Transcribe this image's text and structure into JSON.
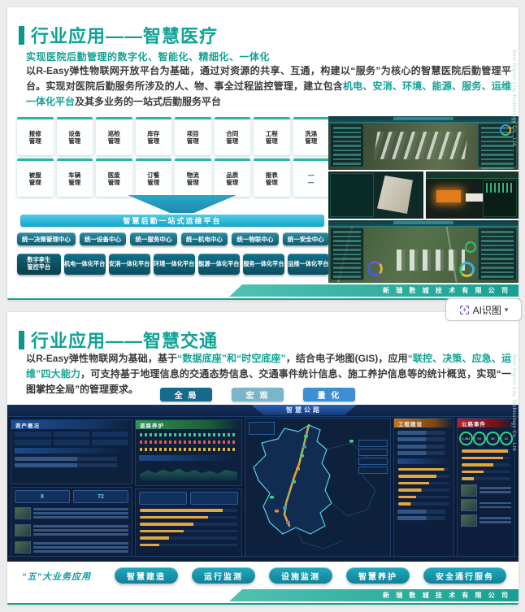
{
  "ai_tool": {
    "label": "AI识图",
    "chevron": "▾"
  },
  "company": {
    "name": "新 瑞 数 城 技 术 有 限 公 司",
    "side": "Best Digital City Technology Co., Ltd"
  },
  "slide1": {
    "title": "行业应用——智慧医疗",
    "subtitle": "实现医院后勤管理的数字化、智能化、精细化、一体化",
    "para": {
      "s1": "以R-Easy弹性物联网开放平台为基础，通过对资源的共享、互通，构建以“服务”为核心的智慧医院后勤管理平台。实现对医院后勤服务所涉及的人、物、事全过程监控管理，建立包含",
      "s2": "机电、安消、环境、能源、服务、运维一体化平台",
      "s3": "及其多业务的一站式后勤服务平台"
    },
    "modules": [
      {
        "l1": "报修",
        "l2": "管理"
      },
      {
        "l1": "设备",
        "l2": "管理"
      },
      {
        "l1": "巡检",
        "l2": "管理"
      },
      {
        "l1": "库存",
        "l2": "管理"
      },
      {
        "l1": "项目",
        "l2": "管理"
      },
      {
        "l1": "合同",
        "l2": "管理"
      },
      {
        "l1": "工程",
        "l2": "管理"
      },
      {
        "l1": "洗涤",
        "l2": "管理"
      },
      {
        "l1": "被服",
        "l2": "管理"
      },
      {
        "l1": "车辆",
        "l2": "管理"
      },
      {
        "l1": "医废",
        "l2": "管理"
      },
      {
        "l1": "订餐",
        "l2": "管理"
      },
      {
        "l1": "物流",
        "l2": "管理"
      },
      {
        "l1": "品质",
        "l2": "管理"
      },
      {
        "l1": "报表",
        "l2": "管理"
      },
      {
        "l1": "—",
        "l2": "—"
      }
    ],
    "funnel_bar": "智慧后勤一站式运维平台",
    "centers": [
      "统一决策管理中心",
      "统一设备中心",
      "统一服务中心",
      "统一机电中心",
      "统一物联中心",
      "统一安全中心"
    ],
    "platforms": [
      {
        "l1": "数字孪生",
        "l2": "管控平台"
      },
      {
        "l1": "机电一体化平台",
        "l2": ""
      },
      {
        "l1": "安消一体化平台",
        "l2": ""
      },
      {
        "l1": "环境一体化平台",
        "l2": ""
      },
      {
        "l1": "能源一体化平台",
        "l2": ""
      },
      {
        "l1": "服务一体化平台",
        "l2": ""
      },
      {
        "l1": "运维一体化平台",
        "l2": ""
      }
    ]
  },
  "slide2": {
    "title": "行业应用——智慧交通",
    "para": {
      "s1": "以R-Easy弹性物联网为基础，基于",
      "s2": "“数据底座”和“时空底座”",
      "s3": "，结合电子地图(GIS)，应用",
      "s4": "“联控、决策、应急、运维”四大能力",
      "s5": "，可支持基于地理信息的交通态势信息、交通事件统计信息、施工养护信息等的统计概览，实现",
      "s6": "“一图掌控全局”",
      "s7": "的管理要求。"
    },
    "view_buttons": [
      "全 局",
      "宏 观",
      "量 化"
    ],
    "dashboard": {
      "title": "智慧公路",
      "panel_assets": "资产概况",
      "panel_maintenance": "道路养护",
      "panel_construction": "工程建设",
      "panel_events": "公路事件",
      "stat_a": "8",
      "stat_b": "72",
      "rings": [
        "4,384",
        "94",
        "28",
        "22"
      ]
    },
    "biz_label": "“五”大业务应用",
    "biz_pills": [
      "智慧建造",
      "运行监测",
      "设施监测",
      "智慧养护",
      "安全通行服务"
    ]
  }
}
